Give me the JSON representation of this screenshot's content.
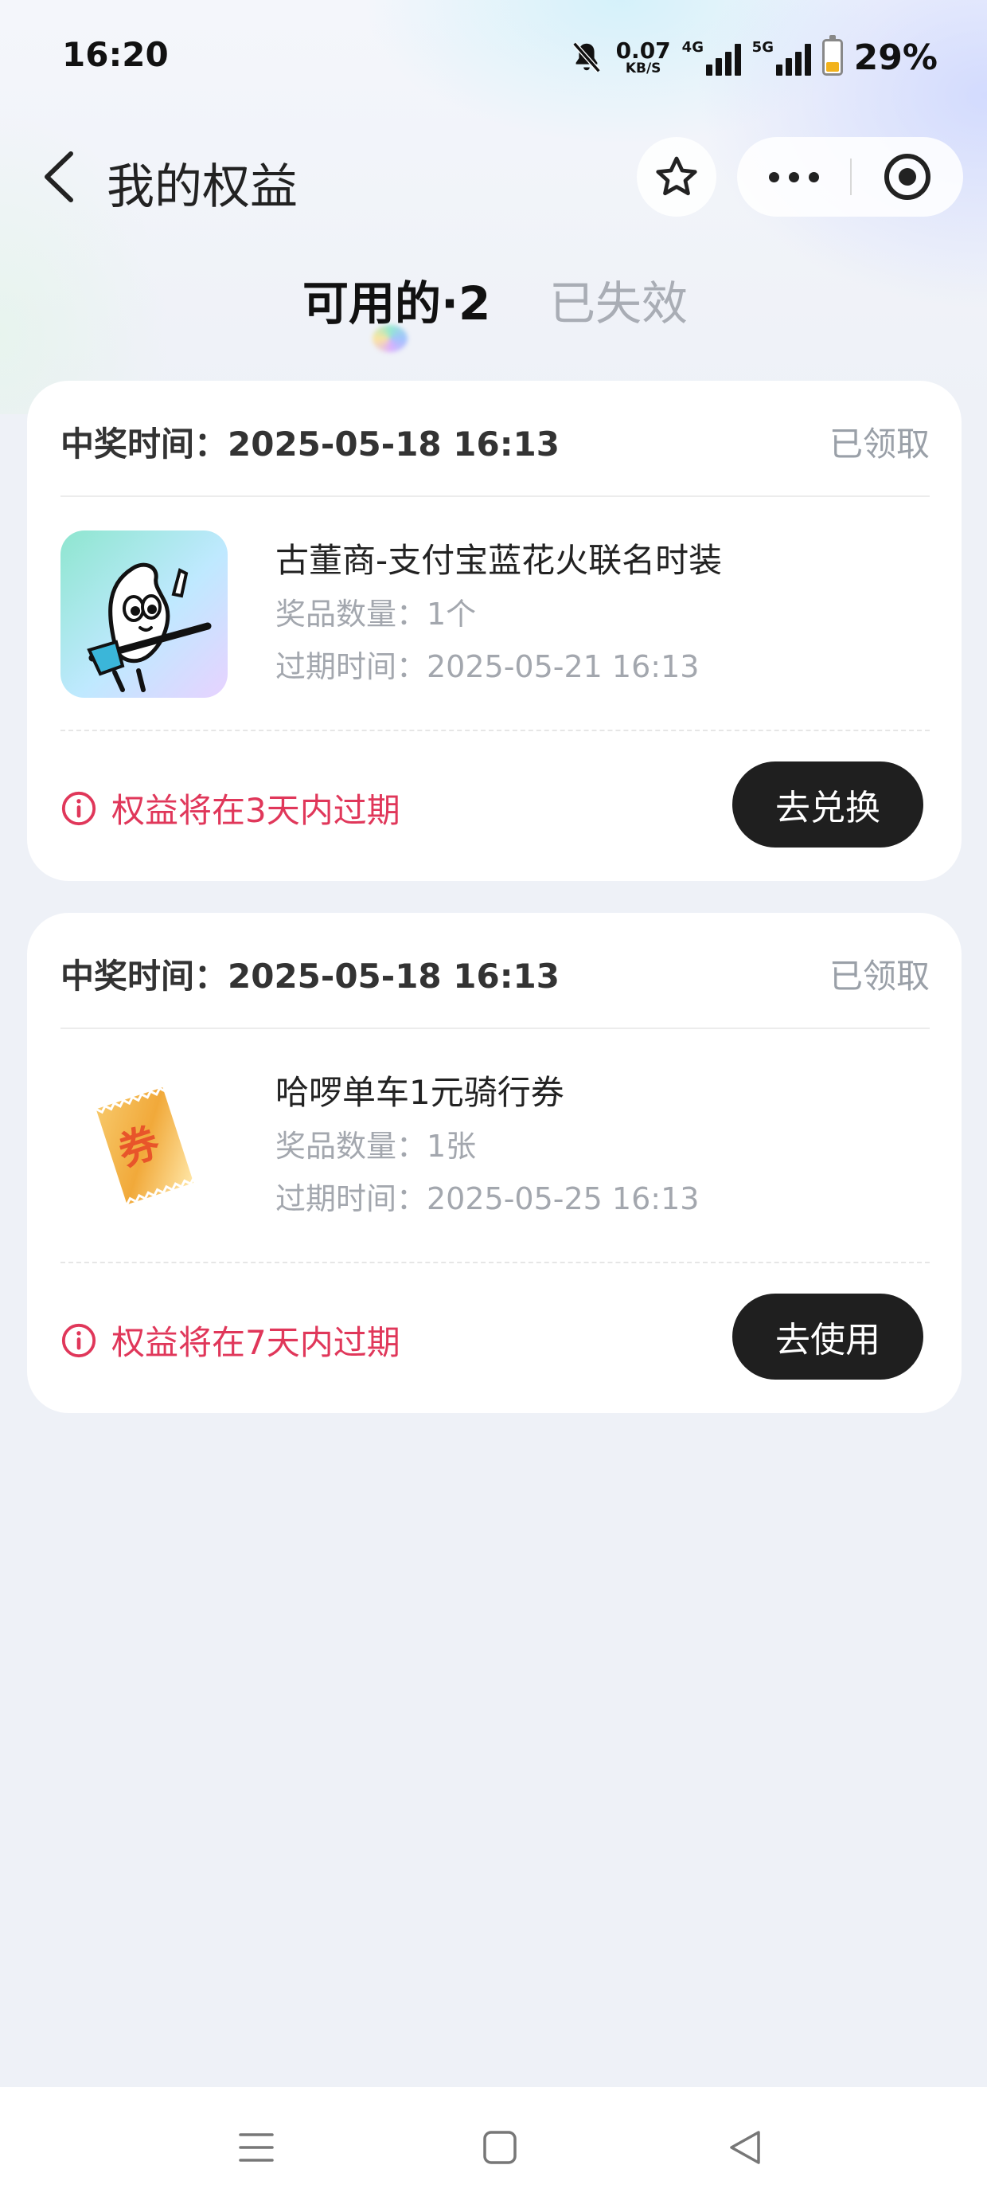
{
  "status_bar": {
    "time": "16:20",
    "net_speed_value": "0.07",
    "net_speed_unit": "KB/S",
    "sim1_tag": "4G",
    "sim2_tag": "5G",
    "battery_percent": "29%",
    "battery_level": 0.29
  },
  "nav": {
    "title": "我的权益"
  },
  "tabs": [
    {
      "label": "可用的·2",
      "active": true
    },
    {
      "label": "已失效",
      "active": false
    }
  ],
  "cards": [
    {
      "win_time": "中奖时间：2025-05-18 16:13",
      "status": "已领取",
      "prize_name": "古董商-支付宝蓝花火联名时装",
      "quantity": "奖品数量：1个",
      "expire": "过期时间：2025-05-21 16:13",
      "warning": "权益将在3天内过期",
      "action": "去兑换"
    },
    {
      "win_time": "中奖时间：2025-05-18 16:13",
      "status": "已领取",
      "prize_name": "哈啰单车1元骑行券",
      "quantity": "奖品数量：1张",
      "expire": "过期时间：2025-05-25 16:13",
      "warning": "权益将在7天内过期",
      "action": "去使用",
      "coupon_glyph": "券"
    }
  ],
  "colors": {
    "background": "#eef1f7",
    "warning_red": "#e0375a",
    "button_dark": "#1f1f1f",
    "muted_text": "#a3a7ae"
  }
}
